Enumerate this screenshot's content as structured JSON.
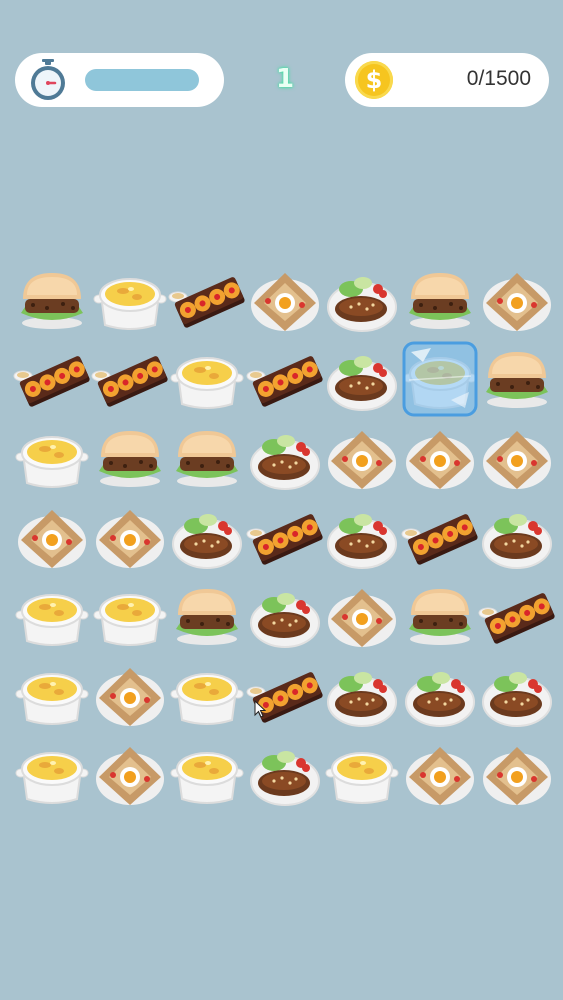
{
  "hud": {
    "level": "1",
    "score": "0/1500",
    "coin_symbol": "$",
    "timer_progress": 1.0
  },
  "board": {
    "rows": 7,
    "cols": 7,
    "frozen_cell": {
      "row": 1,
      "col": 5
    },
    "tiles": [
      [
        "burger",
        "gratin",
        "takoyaki",
        "galette",
        "hamburg-steak",
        "burger",
        "galette"
      ],
      [
        "takoyaki",
        "takoyaki",
        "gratin",
        "takoyaki",
        "hamburg-steak",
        "gratin",
        "burger"
      ],
      [
        "gratin",
        "burger",
        "burger",
        "hamburg-steak",
        "galette",
        "galette",
        "galette"
      ],
      [
        "galette",
        "galette",
        "hamburg-steak",
        "takoyaki",
        "hamburg-steak",
        "takoyaki",
        "hamburg-steak"
      ],
      [
        "gratin",
        "gratin",
        "burger",
        "hamburg-steak",
        "galette",
        "burger",
        "takoyaki"
      ],
      [
        "gratin",
        "galette",
        "gratin",
        "takoyaki",
        "hamburg-steak",
        "hamburg-steak",
        "hamburg-steak"
      ],
      [
        "gratin",
        "galette",
        "gratin",
        "hamburg-steak",
        "gratin",
        "galette",
        "galette"
      ]
    ]
  },
  "colors": {
    "background": "#a9c3cf",
    "timer_bar": "#8fc6da",
    "coin": "#f6c51f",
    "ice": "#6fb5ee"
  }
}
